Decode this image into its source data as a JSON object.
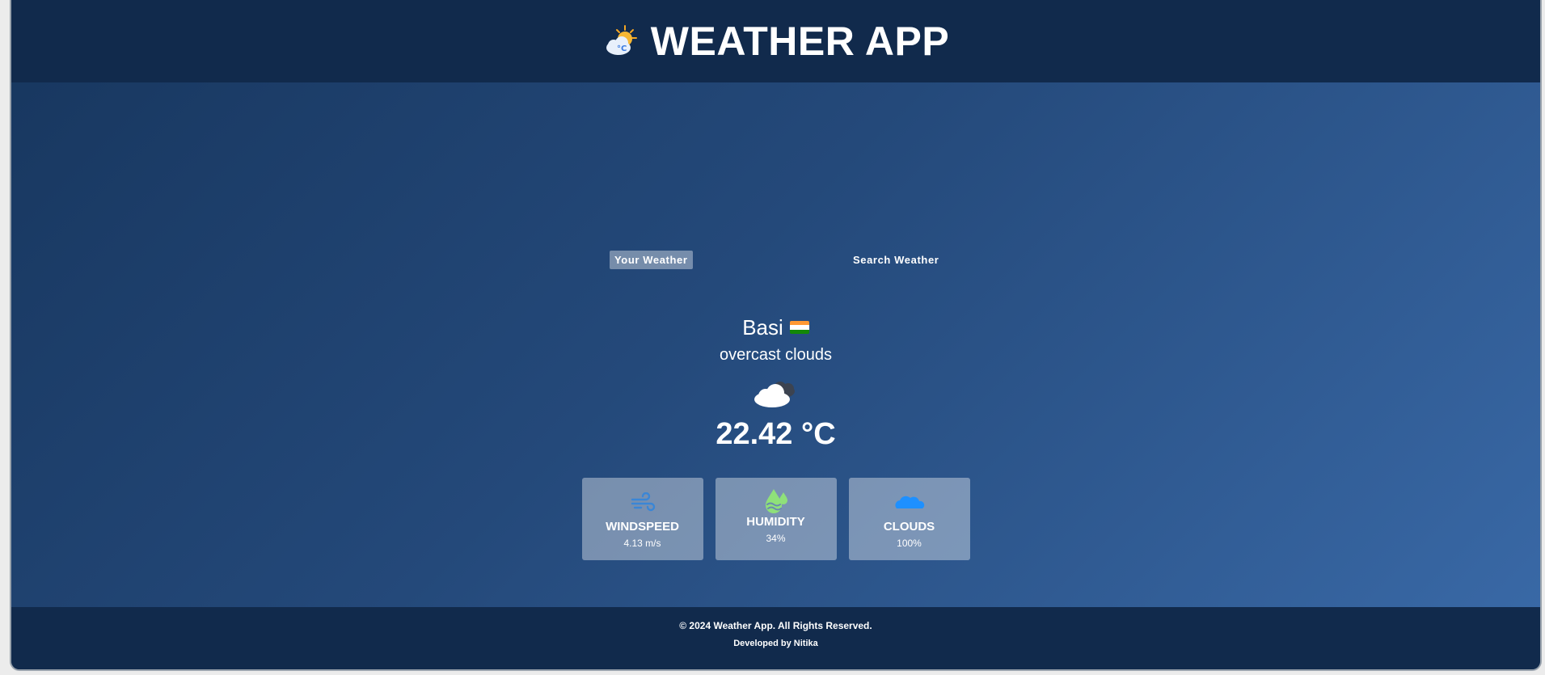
{
  "header": {
    "title": "WEATHER APP",
    "logo_icon": "sun-cloud-celsius-icon"
  },
  "tabs": [
    {
      "label": "Your Weather",
      "active": true
    },
    {
      "label": "Search Weather",
      "active": false
    }
  ],
  "weather": {
    "city": "Basi",
    "country_flag": "india-flag",
    "description": "overcast clouds",
    "condition_icon": "overcast-clouds-icon",
    "temperature": "22.42 °C"
  },
  "stats": [
    {
      "title": "WINDSPEED",
      "value": "4.13 m/s",
      "icon": "wind-icon",
      "color": "#3a86d6"
    },
    {
      "title": "HUMIDITY",
      "value": "34%",
      "icon": "humidity-drops-icon",
      "color": "#8fe07a"
    },
    {
      "title": "CLOUDS",
      "value": "100%",
      "icon": "cloud-icon",
      "color": "#1e90ff"
    }
  ],
  "footer": {
    "copyright": "© 2024 Weather App. All Rights Reserved.",
    "credit": "Developed by Nitika"
  },
  "colors": {
    "header_bg": "#112a4c",
    "gradient_start": "#17365e",
    "gradient_end": "#3a6aa8"
  }
}
